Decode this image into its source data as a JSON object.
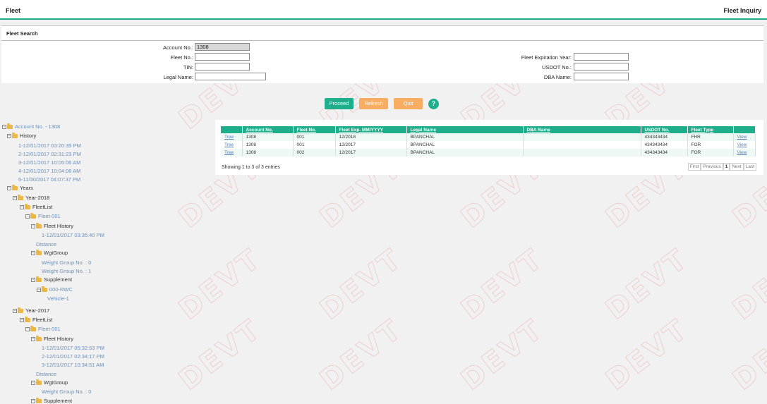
{
  "header": {
    "title": "Fleet",
    "page_name": "Fleet Inquiry"
  },
  "search": {
    "title": "Fleet Search",
    "account_no_label": "Account No.:",
    "account_no_value": "1308",
    "fleet_no_label": "Fleet No.:",
    "tin_label": "TIN:",
    "legal_name_label": "Legal Name:",
    "fleet_exp_label": "Fleet Expiration Year:",
    "usdot_label": "USDOT No.:",
    "dba_label": "DBA Name:"
  },
  "buttons": {
    "proceed": "Proceed",
    "refresh": "Refresh",
    "quit": "Quit",
    "help": "?"
  },
  "watermark": "DEVT",
  "tree": [
    "Account No. - 1308",
    "History",
    "1-12/01/2017 03:20:39 PM",
    "2-12/01/2017 02:31:23 PM",
    "3-12/01/2017 10:05:06 AM",
    "4-12/01/2017 10:04:06 AM",
    "5-11/30/2017 04:07:37 PM",
    "Years",
    "Year-2018",
    "FleetList",
    "Fleet-001",
    "Fleet History",
    "1-12/01/2017 03:35:40 PM",
    "Distance",
    "WgtGroup",
    "Weight Group No. : 0",
    "Weight Group No. : 1",
    "Supplement",
    "000-RWC",
    "Vehicle-1",
    "Year-2017",
    "FleetList",
    "Fleet-001",
    "Fleet History",
    "1-12/01/2017 05:32:53 PM",
    "2-12/01/2017 02:34:17 PM",
    "3-12/01/2017 10:34:51 AM",
    "Distance",
    "WgtGroup",
    "Weight Group No. : 0",
    "Supplement"
  ],
  "table": {
    "headers": [
      "",
      "Account No.",
      "Fleet No.",
      "Fleet Exp. MM/YYYY",
      "Legal Name",
      "DBA Name",
      "USDOT No.",
      "Fleet Type",
      ""
    ],
    "rows": [
      [
        "Tree",
        "1308",
        "001",
        "12/2018",
        "BPANCHAL",
        "",
        "434343434",
        "FHR",
        "View"
      ],
      [
        "Tree",
        "1308",
        "001",
        "12/2017",
        "BPANCHAL",
        "",
        "434343434",
        "FOR",
        "View"
      ],
      [
        "Tree",
        "1308",
        "002",
        "12/2017",
        "BPANCHAL",
        "",
        "434343434",
        "FOR",
        "View"
      ]
    ],
    "showing": "Showing 1 to 3 of 3 entries",
    "pager": {
      "first": "First",
      "previous": "Previous",
      "page": "1",
      "next": "Next",
      "last": "Last"
    }
  }
}
